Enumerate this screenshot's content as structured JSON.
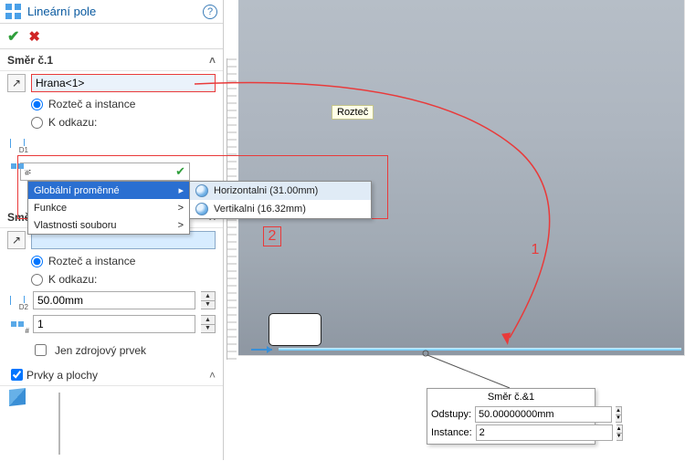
{
  "header": {
    "title": "Lineární pole"
  },
  "dir1": {
    "heading": "Směr č.1",
    "edge_value": "Hrana<1>",
    "radio_spacing": "Rozteč a instance",
    "radio_ref": "K odkazu:",
    "formula_value": "=",
    "count_value": ""
  },
  "dropdown": {
    "item1": "Globální proměnné",
    "item2": "Funkce",
    "item3": "Vlastnosti souboru",
    "sub1": "Horizontalni (31.00mm)",
    "sub2": "Vertikalni (16.32mm)"
  },
  "dir2": {
    "heading": "Směr č.2",
    "radio_spacing": "Rozteč a instance",
    "radio_ref": "K odkazu:",
    "distance_value": "50.00mm",
    "count_value": "1",
    "src_only": "Jen zdrojový prvek"
  },
  "features_section": "Prvky a plochy",
  "tooltip": "Rozteč",
  "annotation1": "1",
  "annotation2": "2",
  "flyout": {
    "title": "Směr č.&1",
    "offset_label": "Odstupy:",
    "offset_value": "50.00000000mm",
    "inst_label": "Instance:",
    "inst_value": "2"
  },
  "icons": {
    "d1": "D1",
    "d2": "D2",
    "hash": "#"
  }
}
